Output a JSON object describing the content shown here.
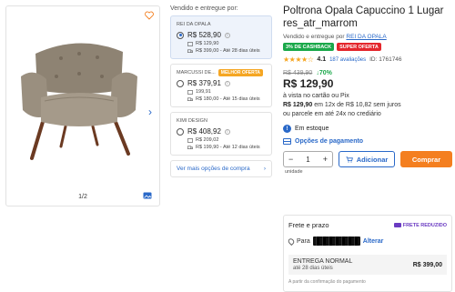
{
  "gallery": {
    "pager": "1/2"
  },
  "sellers": {
    "title": "Vendido e entregue por:",
    "cards": [
      {
        "name": "REI DA OPALA",
        "price": "R$ 528,90",
        "pix_price": "R$ 129,90",
        "shipping": "R$ 399,00 - Até 28 dias úteis",
        "badge": ""
      },
      {
        "name": "MARCUSSI DE...",
        "price": "R$ 379,91",
        "pix_price": "199,91",
        "shipping": "R$ 180,00 - Até 15 dias úteis",
        "badge": "MELHOR OFERTA"
      },
      {
        "name": "KIMI DESIGN",
        "price": "R$ 408,92",
        "pix_price": "R$ 209,02",
        "shipping": "R$ 199,90 - Até 12 dias úteis",
        "badge": ""
      }
    ],
    "more_offers": "Ver mais opções de compra"
  },
  "product": {
    "title": "Poltrona Opala Capuccino 1 Lugar res_atr_marrom",
    "sold_by_prefix": "Vendido e entregue por",
    "sold_by_seller": "REI DA OPALA",
    "tag_cashback": "3% DE CASHBACK",
    "tag_offer": "SUPER OFERTA",
    "stars": "★★★★☆",
    "rating": "4.1",
    "reviews": "187 avaliações",
    "id": "ID: 1761746",
    "old_price": "R$ 439,90",
    "discount": "↓70%",
    "price": "R$ 129,90",
    "pix_label": "à vista no cartão ou Pix",
    "installments_price": "R$ 129,90",
    "installments_text": "em 12x de R$ 10,82 sem juros",
    "installments_credit": "ou parcele em até 24x no crediário",
    "stock": "Em estoque",
    "payment_options": "Opções de pagamento",
    "qty_value": "1",
    "qty_minus": "−",
    "qty_plus": "+",
    "qty_unit": "unidade",
    "add_label": "Adicionar",
    "buy_label": "Comprar"
  },
  "shipping": {
    "title": "Frete e prazo",
    "free_label": "FRETE REDUZIDO",
    "cep_prefix": "Para",
    "alter_label": "Alterar",
    "method_name": "ENTREGA NORMAL",
    "method_eta": "até 28 dias úteis",
    "method_price": "R$ 399,00",
    "note": "A partir da confirmação do pagamento"
  },
  "colors": {
    "accent": "#2968c8",
    "buy": "#f47f20",
    "success": "#1aa84a",
    "danger": "#e4262c"
  }
}
